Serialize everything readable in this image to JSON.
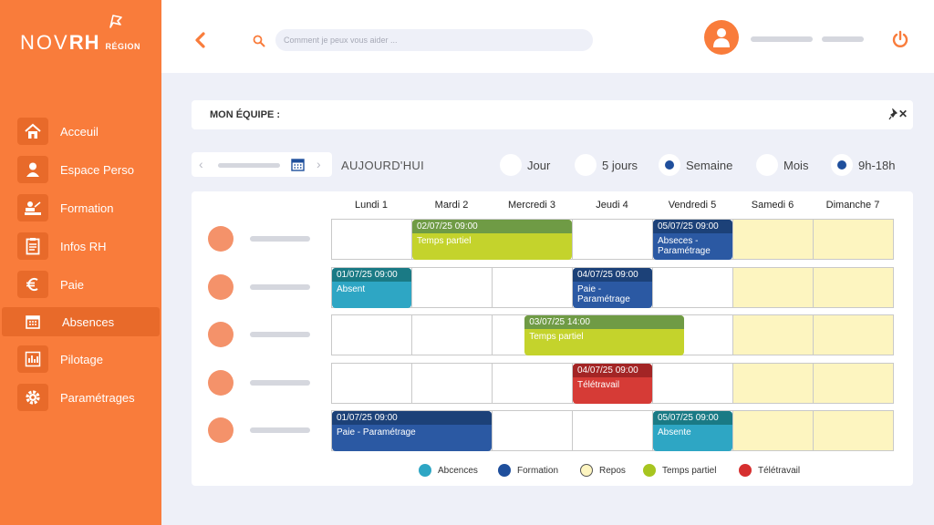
{
  "brand": {
    "nov": "NOV",
    "rh": "RH",
    "region": "RÉGION"
  },
  "sidebar": {
    "items": [
      {
        "label": "Acceuil",
        "icon": "home-icon"
      },
      {
        "label": "Espace Perso",
        "icon": "user-icon"
      },
      {
        "label": "Formation",
        "icon": "training-icon"
      },
      {
        "label": "Infos RH",
        "icon": "clipboard-icon"
      },
      {
        "label": "Paie",
        "icon": "euro-icon"
      },
      {
        "label": "Absences",
        "icon": "calendar-icon",
        "active": true
      },
      {
        "label": "Pilotage",
        "icon": "chart-icon"
      },
      {
        "label": "Paramétrages",
        "icon": "gear-icon"
      }
    ]
  },
  "search": {
    "placeholder": "Comment je peux vous aider ..."
  },
  "team": {
    "title": "MON ÉQUIPE :",
    "close": "✕"
  },
  "datenav": {
    "prev": "‹",
    "next": "›",
    "today": "AUJOURD'HUI"
  },
  "views": [
    {
      "label": "Jour",
      "selected": false
    },
    {
      "label": "5 jours",
      "selected": false
    },
    {
      "label": "Semaine",
      "selected": true
    },
    {
      "label": "Mois",
      "selected": false
    },
    {
      "label": "9h-18h",
      "selected": true
    }
  ],
  "days": [
    "Lundi 1",
    "Mardi 2",
    "Mercredi 3",
    "Jeudi 4",
    "Vendredi 5",
    "Samedi 6",
    "Dimanche 7"
  ],
  "events": [
    {
      "row": 0,
      "start": 1,
      "span": 2,
      "head": "02/07/25  09:00",
      "body": "Temps partiel",
      "type": "partiel"
    },
    {
      "row": 0,
      "start": 4,
      "span": 1,
      "head": "05/07/25  09:00",
      "body": "Abseces - Paramétrage",
      "type": "formation"
    },
    {
      "row": 1,
      "start": 0,
      "span": 1,
      "head": "01/07/25  09:00",
      "body": "Absent",
      "type": "absence"
    },
    {
      "row": 1,
      "start": 3,
      "span": 1,
      "head": "04/07/25  09:00",
      "body": "Paie - Paramétrage",
      "type": "formation"
    },
    {
      "row": 2,
      "start": 2.4,
      "span": 2,
      "head": "03/07/25  14:00",
      "body": "Temps partiel",
      "type": "partiel"
    },
    {
      "row": 3,
      "start": 3,
      "span": 1,
      "head": "04/07/25  09:00",
      "body": "Télétravail",
      "type": "teletravail"
    },
    {
      "row": 4,
      "start": 0,
      "span": 2,
      "head": "01/07/25  09:00",
      "body": "Paie - Paramétrage",
      "type": "formation"
    },
    {
      "row": 4,
      "start": 4,
      "span": 1,
      "head": "05/07/25  09:00",
      "body": "Absente",
      "type": "absence"
    }
  ],
  "legend": [
    {
      "label": "Abcences",
      "color": "#2ea6c4"
    },
    {
      "label": "Formation",
      "color": "#1f4f9c"
    },
    {
      "label": "Repos",
      "color": "#fdf5c0"
    },
    {
      "label": "Temps partiel",
      "color": "#a7c520"
    },
    {
      "label": "Télétravail",
      "color": "#d62f2f"
    }
  ],
  "colors": {
    "accent": "#f97c3b",
    "absence_head": "#1a7a85",
    "absence_body": "#2ea6c4",
    "formation_head": "#1c4178",
    "formation_body": "#2b59a3",
    "partiel_head": "#6f9b45",
    "partiel_body": "#c4d32c",
    "teletravail_head": "#a32525",
    "teletravail_body": "#d63b36"
  }
}
